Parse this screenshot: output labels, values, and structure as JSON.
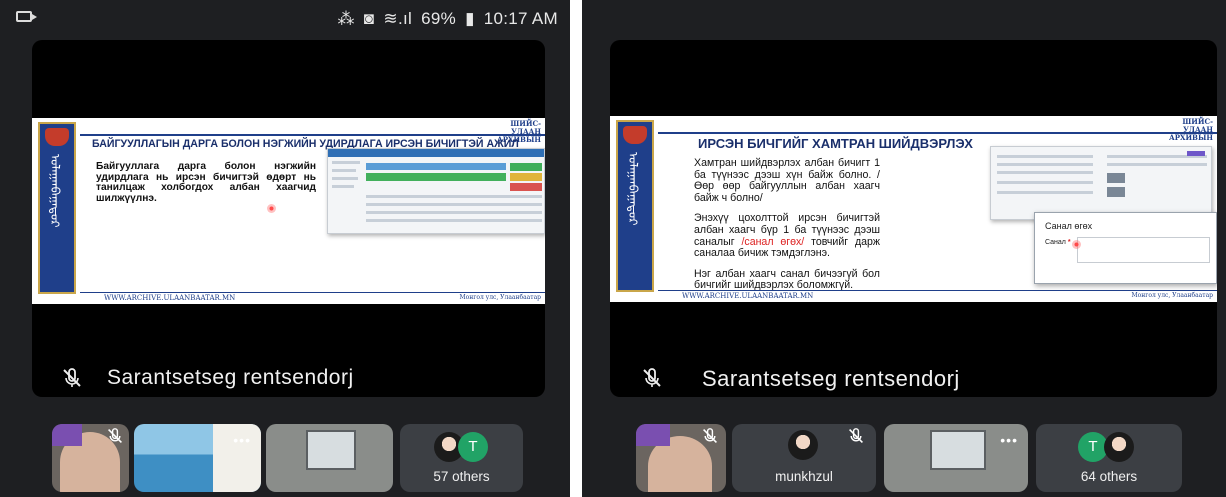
{
  "status_bar": {
    "battery": "69%",
    "time": "10:17 AM"
  },
  "left": {
    "slide": {
      "archive_label": "ШИЙС-УЛААН\nАРХИВЫН",
      "heading": "БАЙГУУЛЛАГЫН ДАРГА БОЛОН НЭГЖИЙН УДИРДЛАГА ИРСЭН БИЧИГТЭЙ АЖИЛ",
      "body": "Байгууллага дарга болон нэгжийн удирдлага нь ирсэн бичигтэй өдөрт нь танилцаж холбогдох албан хаагчид шилжүүлнэ.",
      "footer": "WWW.ARCHIVE.ULAANBAATAR.MN",
      "footer_right": "Монгол улс, Улаанбаатар"
    },
    "speaker_name": "Sarantsetseg rentsendorj",
    "participants_label": "57 others",
    "avatar_letter": "T"
  },
  "right": {
    "slide": {
      "archive_label": "ШИЙС-УЛААН\nАРХИВЫН",
      "heading": "ИРСЭН БИЧГИЙГ ХАМТРАН ШИЙДВЭРЛЭХ",
      "para1": "Хамтран шийдвэрлэх албан бичигт 1 ба түүнээс дээш хүн байж болно. /Өөр өөр байгууллын албан хаагч байж ч болно/",
      "para2_a": "Энэхүү цохолттой ирсэн бичигтэй албан хаагч бүр 1 ба түүнээс дээш саналыг ",
      "para2_hl": "/санал өгөх/",
      "para2_b": " товчийг дарж саналаа бичиж тэмдэглэнэ.",
      "para3": "Нэг албан хаагч санал бичээгүй бол бичгийг шийдвэрлэх боломжгүй.",
      "dialog_title": "Санал өгөх",
      "dialog_field": "Санал",
      "footer": "WWW.ARCHIVE.ULAANBAATAR.MN",
      "footer_right": "Монгол улс, Улаанбаатар"
    },
    "speaker_name": "Sarantsetseg rentsendorj",
    "tile_name": "munkhzul",
    "participants_label": "64 others",
    "avatar_letter": "T"
  }
}
